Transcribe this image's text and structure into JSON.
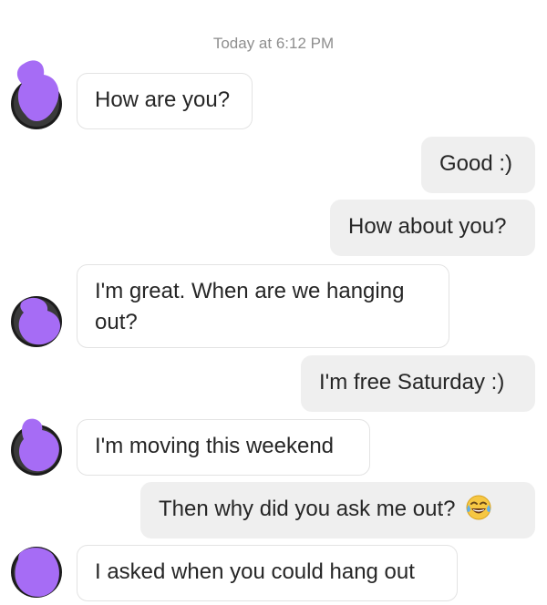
{
  "thread": {
    "timestamp": "Today at 6:12 PM",
    "messages": [
      {
        "from": "them",
        "text": "How are you?"
      },
      {
        "from": "me",
        "text": "Good :)"
      },
      {
        "from": "me",
        "text": "How about you?"
      },
      {
        "from": "them",
        "text": "I'm great. When are we hanging out?"
      },
      {
        "from": "me",
        "text": "I'm free Saturday :)"
      },
      {
        "from": "them",
        "text": "I'm moving this weekend"
      },
      {
        "from": "me",
        "text": "Then why did you ask me out?",
        "emoji": "tears-of-joy-emoji"
      },
      {
        "from": "them",
        "text": "I asked when you could hang out"
      }
    ]
  },
  "colors": {
    "incoming_bubble_bg": "#ffffff",
    "incoming_bubble_border": "#e3e3e3",
    "outgoing_bubble_bg": "#efefef",
    "avatar_scribble": "#a66cf5",
    "avatar_base": "#1c1c1c"
  }
}
